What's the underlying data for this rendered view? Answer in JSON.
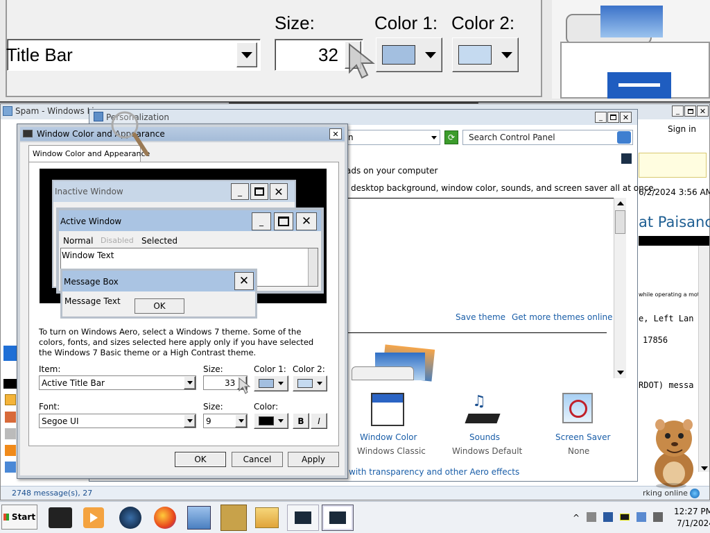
{
  "magnifier": {
    "size_label": "Size:",
    "color1_label": "Color 1:",
    "color2_label": "Color 2:",
    "item_value": "Title Bar",
    "size_value": "32"
  },
  "background_window": {
    "title": "Spam - Windows Li",
    "sign_in": "Sign in",
    "date_text": "6/2/2024 3:56 AM",
    "heading_fragment": "at Paisanc",
    "line1": "while operating a moto",
    "line2": "e, Left Lan",
    "line3": "17856",
    "line4": "RDOT) messa",
    "status_left": "2748 message(s), 27",
    "status_right": "rking online"
  },
  "personalization": {
    "title": "Personalization",
    "address_fragment": "n",
    "search_placeholder": "Search Control Panel",
    "intro1": "ads on your computer",
    "intro2": "desktop background, window color, sounds, and screen saver all at once.",
    "save_theme": "Save theme",
    "get_more": "Get more themes online",
    "items": [
      {
        "label": "Window Color",
        "sub": "Windows Classic"
      },
      {
        "label": "Sounds",
        "sub": "Windows Default"
      },
      {
        "label": "Screen Saver",
        "sub": "None"
      }
    ],
    "aero_link": "with transparency and other Aero effects"
  },
  "dialog": {
    "title": "Window Color and Appearance",
    "tab": "Window Color and Appearance",
    "preview": {
      "inactive": "Inactive Window",
      "active": "Active Window",
      "menu_normal": "Normal",
      "menu_disabled": "Disabled",
      "menu_selected": "Selected",
      "window_text": "Window Text",
      "msgbox_title": "Message Box",
      "msgbox_text": "Message Text",
      "ok": "OK"
    },
    "info": "To turn on Windows Aero, select a Windows 7 theme.  Some of the colors, fonts, and sizes selected here apply only if you have selected the Windows 7 Basic theme or a High Contrast theme.",
    "item_label": "Item:",
    "item_value": "Active Title Bar",
    "size_label": "Size:",
    "size_value": "33",
    "color1_label": "Color 1:",
    "color2_label": "Color 2:",
    "font_label": "Font:",
    "font_value": "Segoe UI",
    "font_size_label": "Size:",
    "font_size_value": "9",
    "font_color_label": "Color:",
    "bold": "B",
    "italic": "I",
    "ok": "OK",
    "cancel": "Cancel",
    "apply": "Apply"
  },
  "taskbar": {
    "start": "Start",
    "time": "12:27 PM",
    "date": "7/1/2024"
  },
  "colors": {
    "color1": "#a3bfe0",
    "color2": "#c5daf0",
    "font_color": "#000000",
    "title_inactive": "#c8d7e8",
    "title_active": "#aac4e3",
    "link": "#1a5ea8",
    "preview_bg": "#000000"
  }
}
